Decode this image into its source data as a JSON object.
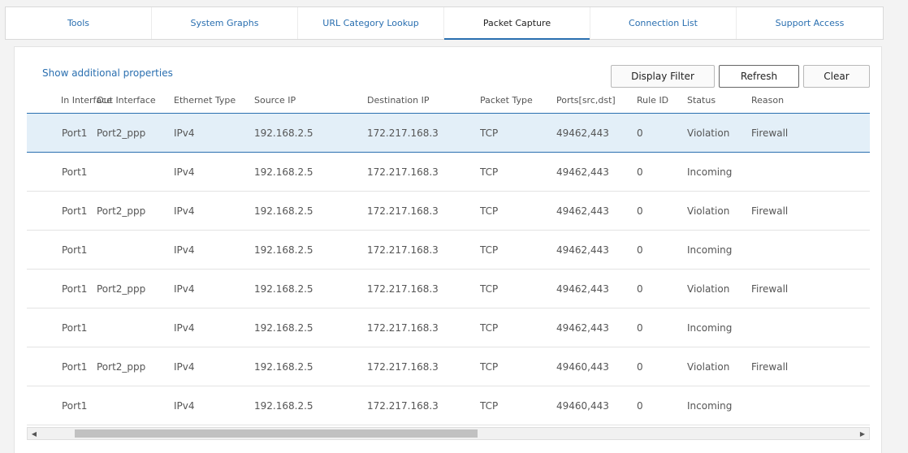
{
  "tabs": [
    {
      "label": "Tools"
    },
    {
      "label": "System Graphs"
    },
    {
      "label": "URL Category Lookup"
    },
    {
      "label": "Packet Capture"
    },
    {
      "label": "Connection List"
    },
    {
      "label": "Support Access"
    }
  ],
  "active_tab": "Packet Capture",
  "toolbar": {
    "props_link": "Show additional properties",
    "display_filter": "Display Filter",
    "refresh": "Refresh",
    "clear": "Clear"
  },
  "table": {
    "columns": [
      "In Interface",
      "Out Interface",
      "Ethernet Type",
      "Source IP",
      "Destination IP",
      "Packet Type",
      "Ports[src,dst]",
      "Rule ID",
      "Status",
      "Reason"
    ],
    "rows": [
      [
        "Port1",
        "Port2_ppp",
        "IPv4",
        "192.168.2.5",
        "172.217.168.3",
        "TCP",
        "49462,443",
        "0",
        "Violation",
        "Firewall"
      ],
      [
        "Port1",
        "",
        "IPv4",
        "192.168.2.5",
        "172.217.168.3",
        "TCP",
        "49462,443",
        "0",
        "Incoming",
        ""
      ],
      [
        "Port1",
        "Port2_ppp",
        "IPv4",
        "192.168.2.5",
        "172.217.168.3",
        "TCP",
        "49462,443",
        "0",
        "Violation",
        "Firewall"
      ],
      [
        "Port1",
        "",
        "IPv4",
        "192.168.2.5",
        "172.217.168.3",
        "TCP",
        "49462,443",
        "0",
        "Incoming",
        ""
      ],
      [
        "Port1",
        "Port2_ppp",
        "IPv4",
        "192.168.2.5",
        "172.217.168.3",
        "TCP",
        "49462,443",
        "0",
        "Violation",
        "Firewall"
      ],
      [
        "Port1",
        "",
        "IPv4",
        "192.168.2.5",
        "172.217.168.3",
        "TCP",
        "49462,443",
        "0",
        "Incoming",
        ""
      ],
      [
        "Port1",
        "Port2_ppp",
        "IPv4",
        "192.168.2.5",
        "172.217.168.3",
        "TCP",
        "49460,443",
        "0",
        "Violation",
        "Firewall"
      ],
      [
        "Port1",
        "",
        "IPv4",
        "192.168.2.5",
        "172.217.168.3",
        "TCP",
        "49460,443",
        "0",
        "Incoming",
        ""
      ]
    ]
  },
  "scrollbar": {
    "left_arrow": "◀",
    "right_arrow": "▶"
  },
  "colors": {
    "accent": "#2a6fb0",
    "selected_row": "#e3eff8"
  }
}
